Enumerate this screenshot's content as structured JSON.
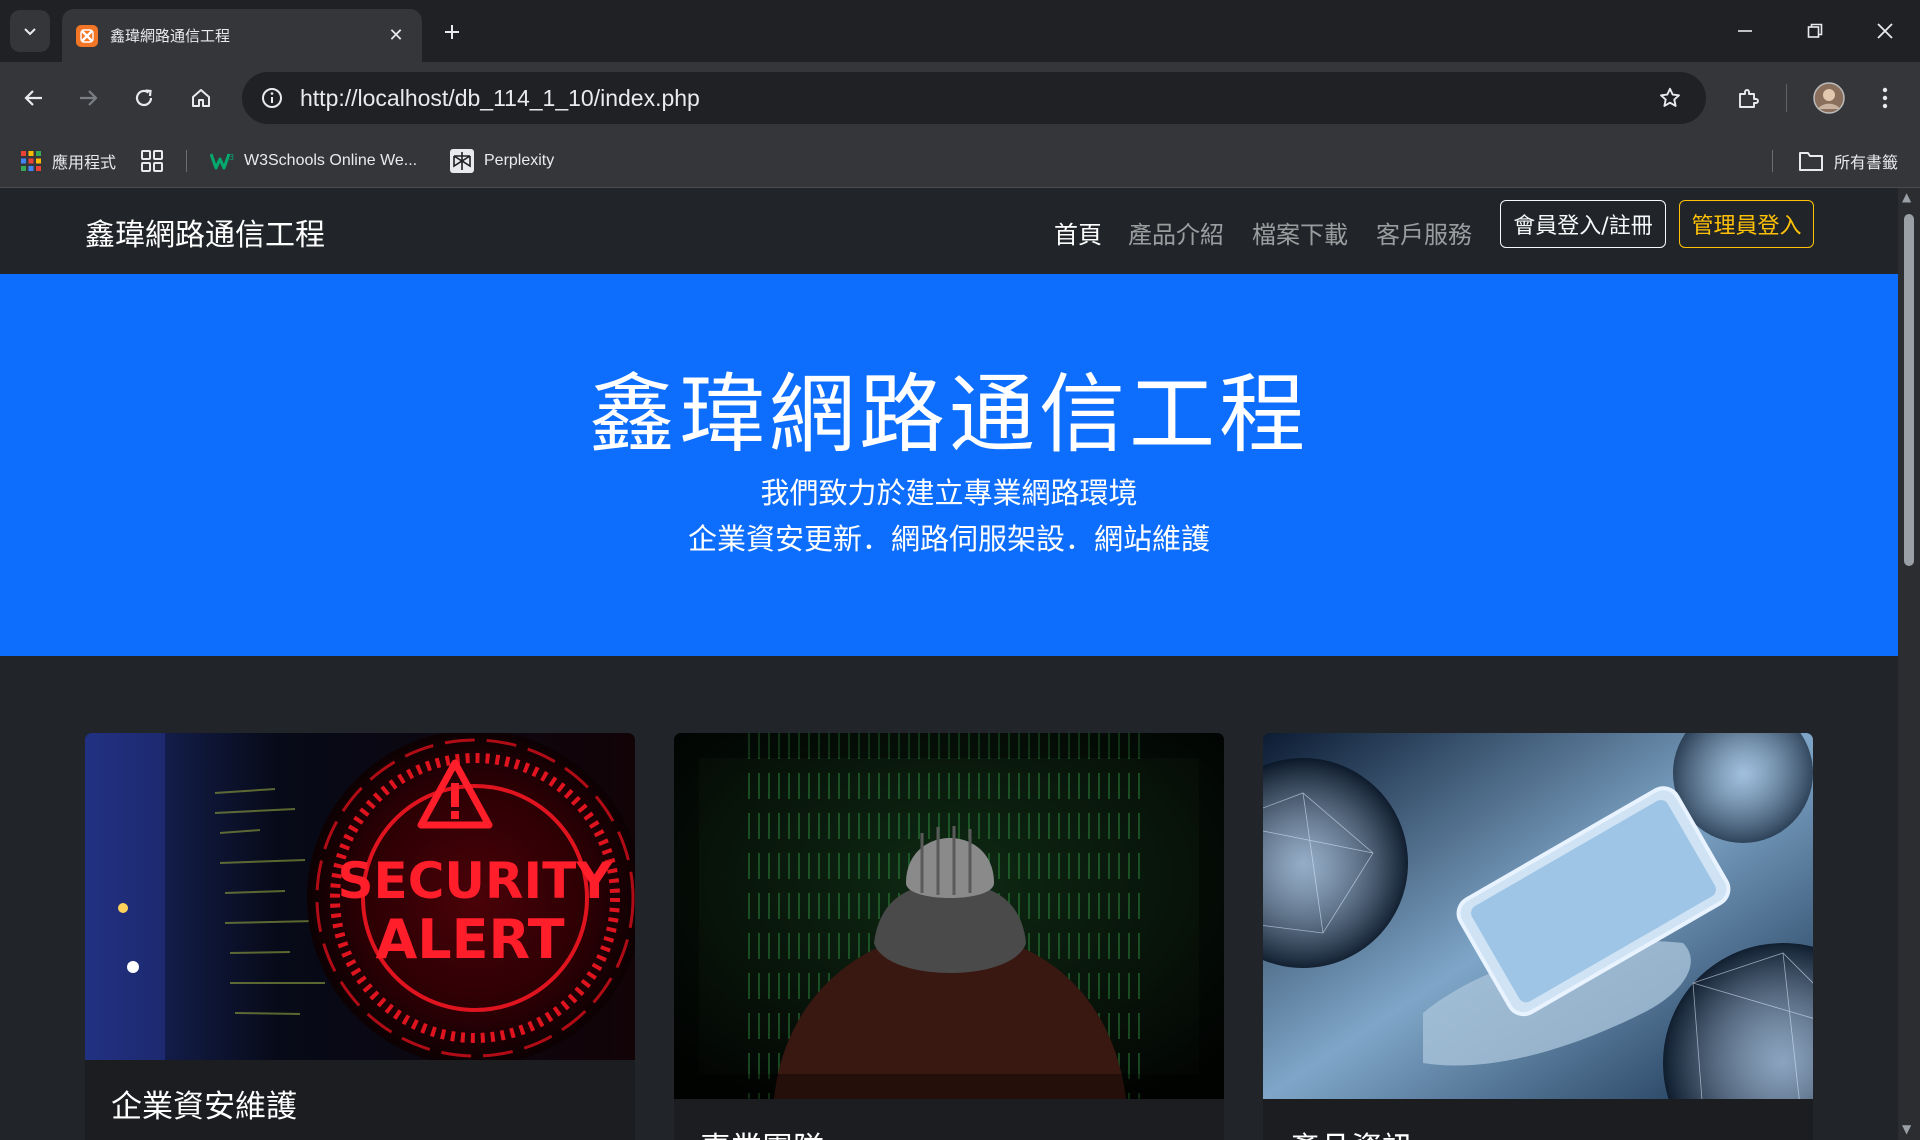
{
  "browser": {
    "tab_title": "鑫瑋網路通信工程",
    "url": "http://localhost/db_114_1_10/index.php",
    "bookmarks": {
      "apps": "應用程式",
      "w3schools": "W3Schools Online We...",
      "perplexity": "Perplexity",
      "all_bookmarks": "所有書籤"
    }
  },
  "site": {
    "brand": "鑫瑋網路通信工程",
    "nav": {
      "home": "首頁",
      "products": "產品介紹",
      "downloads": "檔案下載",
      "service": "客戶服務",
      "member_login": "會員登入/註冊",
      "admin_login": "管理員登入"
    },
    "hero": {
      "title": "鑫瑋網路通信工程",
      "line1": "我們致力於建立專業網路環境",
      "line2": "企業資安更新．網路伺服架設．網站維護"
    },
    "cards": [
      {
        "title": "企業資安維護",
        "image_text": [
          "SECURITY",
          "ALERT"
        ]
      },
      {
        "title": "專業團隊"
      },
      {
        "title": "產品資訊"
      }
    ]
  },
  "colors": {
    "hero_bg": "#0d6efd",
    "page_bg": "#212529",
    "warning": "#ffc107"
  }
}
